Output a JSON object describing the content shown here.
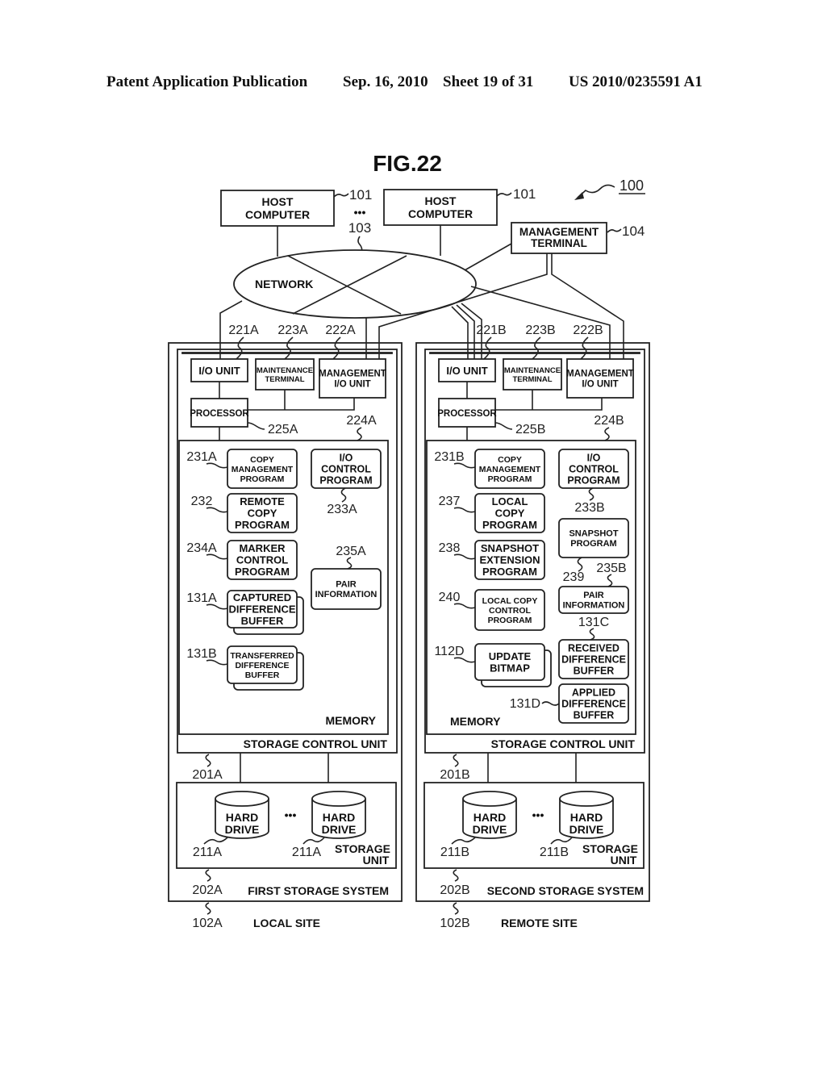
{
  "header": {
    "publication": "Patent Application Publication",
    "date": "Sep. 16, 2010",
    "sheet": "Sheet 19 of 31",
    "number": "US 2010/0235591 A1"
  },
  "figure": {
    "title": "FIG.22",
    "system_ref": "100",
    "hosts": [
      {
        "label": [
          "HOST",
          "COMPUTER"
        ],
        "ref": "101"
      },
      {
        "label": [
          "HOST",
          "COMPUTER"
        ],
        "ref": "101"
      }
    ],
    "ellipsis": "•••",
    "network": {
      "label": "NETWORK",
      "ref": "103"
    },
    "management_terminal": {
      "label": [
        "MANAGEMENT",
        "TERMINAL"
      ],
      "ref": "104"
    },
    "sites": [
      {
        "site_label": "LOCAL SITE",
        "site_ref": "102A",
        "system_label": "FIRST STORAGE SYSTEM",
        "system_ref": "202A",
        "control_unit_label": "STORAGE CONTROL UNIT",
        "control_unit_ref": "201A",
        "io_unit": {
          "label": "I/O UNIT",
          "ref": "221A"
        },
        "maintenance_terminal": {
          "label": [
            "MAINTENANCE",
            "TERMINAL"
          ],
          "ref": "223A"
        },
        "management_io_unit": {
          "label": [
            "MANAGEMENT",
            "I/O UNIT"
          ],
          "ref": "222A"
        },
        "processor": {
          "label": "PROCESSOR",
          "ref": "225A"
        },
        "memory": {
          "label": "MEMORY",
          "ref": "224A"
        },
        "programs": [
          {
            "label": [
              "COPY",
              "MANAGEMENT",
              "PROGRAM"
            ],
            "ref": "231A"
          },
          {
            "label": [
              "REMOTE",
              "COPY",
              "PROGRAM"
            ],
            "ref": "232"
          },
          {
            "label": [
              "MARKER",
              "CONTROL",
              "PROGRAM"
            ],
            "ref": "234A"
          },
          {
            "label": [
              "CAPTURED",
              "DIFFERENCE",
              "BUFFER"
            ],
            "ref": "131A"
          },
          {
            "label": [
              "TRANSFERRED",
              "DIFFERENCE",
              "BUFFER"
            ],
            "ref": "131B"
          }
        ],
        "right_items": [
          {
            "label": [
              "I/O",
              "CONTROL",
              "PROGRAM"
            ],
            "ref": "233A"
          },
          {
            "label": [
              "PAIR",
              "INFORMATION"
            ],
            "ref": "235A"
          }
        ],
        "storage_unit": {
          "label": [
            "STORAGE",
            "UNIT"
          ],
          "drives": [
            {
              "label": [
                "HARD",
                "DRIVE"
              ],
              "ref": "211A"
            },
            {
              "label": [
                "HARD",
                "DRIVE"
              ],
              "ref": "211A"
            }
          ]
        }
      },
      {
        "site_label": "REMOTE SITE",
        "site_ref": "102B",
        "system_label": "SECOND STORAGE SYSTEM",
        "system_ref": "202B",
        "control_unit_label": "STORAGE CONTROL UNIT",
        "control_unit_ref": "201B",
        "io_unit": {
          "label": "I/O UNIT",
          "ref": "221B"
        },
        "maintenance_terminal": {
          "label": [
            "MAINTENANCE",
            "TERMINAL"
          ],
          "ref": "223B"
        },
        "management_io_unit": {
          "label": [
            "MANAGEMENT",
            "I/O UNIT"
          ],
          "ref": "222B"
        },
        "processor": {
          "label": "PROCESSOR",
          "ref": "225B"
        },
        "memory": {
          "label": "MEMORY",
          "ref": "224B"
        },
        "programs": [
          {
            "label": [
              "COPY",
              "MANAGEMENT",
              "PROGRAM"
            ],
            "ref": "231B"
          },
          {
            "label": [
              "LOCAL",
              "COPY",
              "PROGRAM"
            ],
            "ref": "237"
          },
          {
            "label": [
              "SNAPSHOT",
              "EXTENSION",
              "PROGRAM"
            ],
            "ref": "238"
          },
          {
            "label": [
              "LOCAL COPY",
              "CONTROL",
              "PROGRAM"
            ],
            "ref": "240"
          },
          {
            "label": [
              "UPDATE",
              "BITMAP"
            ],
            "ref": "112D"
          }
        ],
        "right_items": [
          {
            "label": [
              "I/O",
              "CONTROL",
              "PROGRAM"
            ],
            "ref": "233B"
          },
          {
            "label": [
              "SNAPSHOT",
              "PROGRAM"
            ],
            "ref": "239"
          },
          {
            "label": [
              "PAIR",
              "INFORMATION"
            ],
            "ref": "235B"
          },
          {
            "label": [
              "RECEIVED",
              "DIFFERENCE",
              "BUFFER"
            ],
            "ref": "131C"
          },
          {
            "label": [
              "APPLIED",
              "DIFFERENCE",
              "BUFFER"
            ],
            "ref": "131D"
          }
        ],
        "storage_unit": {
          "label": [
            "STORAGE",
            "UNIT"
          ],
          "drives": [
            {
              "label": [
                "HARD",
                "DRIVE"
              ],
              "ref": "211B"
            },
            {
              "label": [
                "HARD",
                "DRIVE"
              ],
              "ref": "211B"
            }
          ]
        }
      }
    ]
  }
}
